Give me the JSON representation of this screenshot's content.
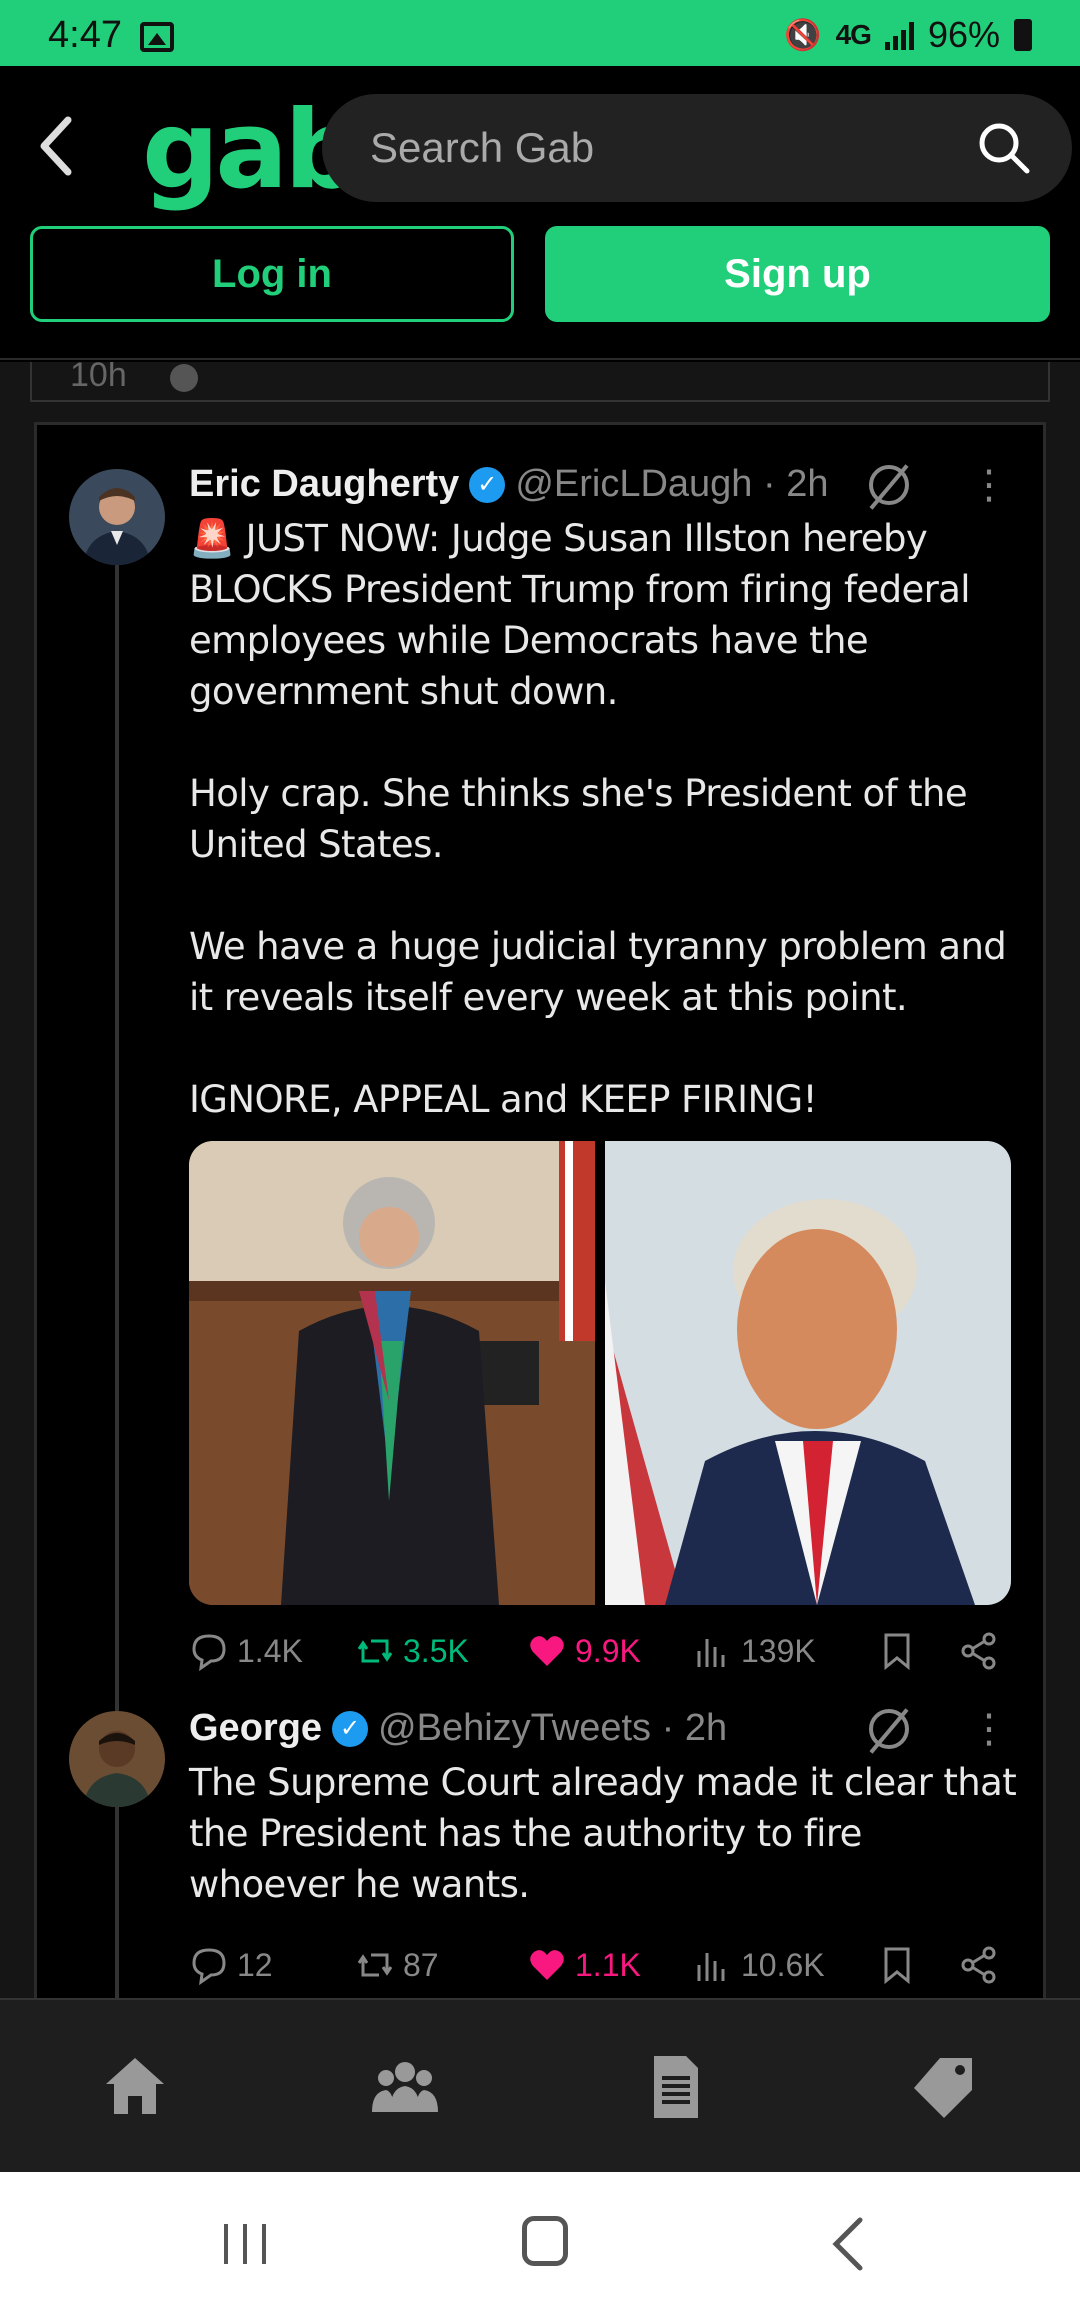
{
  "status_bar": {
    "time": "4:47",
    "network": "4G",
    "battery": "96%"
  },
  "header": {
    "logo": "gab",
    "search_placeholder": "Search Gab",
    "login_label": "Log in",
    "signup_label": "Sign up"
  },
  "previous_post": {
    "timestamp": "10h"
  },
  "tweets": [
    {
      "name": "Eric Daugherty",
      "handle": "@EricLDaugh · 2h",
      "body": "🚨 JUST NOW: Judge Susan Illston hereby BLOCKS President Trump from firing federal employees while Democrats have the government shut down.\n\nHoly crap. She thinks she's President of the United States.\n\nWe have a huge judicial tyranny problem and it reveals itself every week at this point.\n\nIGNORE, APPEAL and KEEP FIRING!",
      "replies": "1.4K",
      "reposts": "3.5K",
      "likes": "9.9K",
      "views": "139K"
    },
    {
      "name": "George",
      "handle": "@BehizyTweets · 2h",
      "body": "The Supreme Court already made it clear that the President has the authority to fire whoever he wants.",
      "replies": "12",
      "reposts": "87",
      "likes": "1.1K",
      "views": "10.6K"
    }
  ],
  "colors": {
    "brand": "#21cf7a",
    "like": "#f91880",
    "repost": "#00ba7c",
    "verified": "#1d9bf0"
  },
  "bottom_nav": [
    "home-icon",
    "groups-icon",
    "news-icon",
    "tags-icon"
  ]
}
